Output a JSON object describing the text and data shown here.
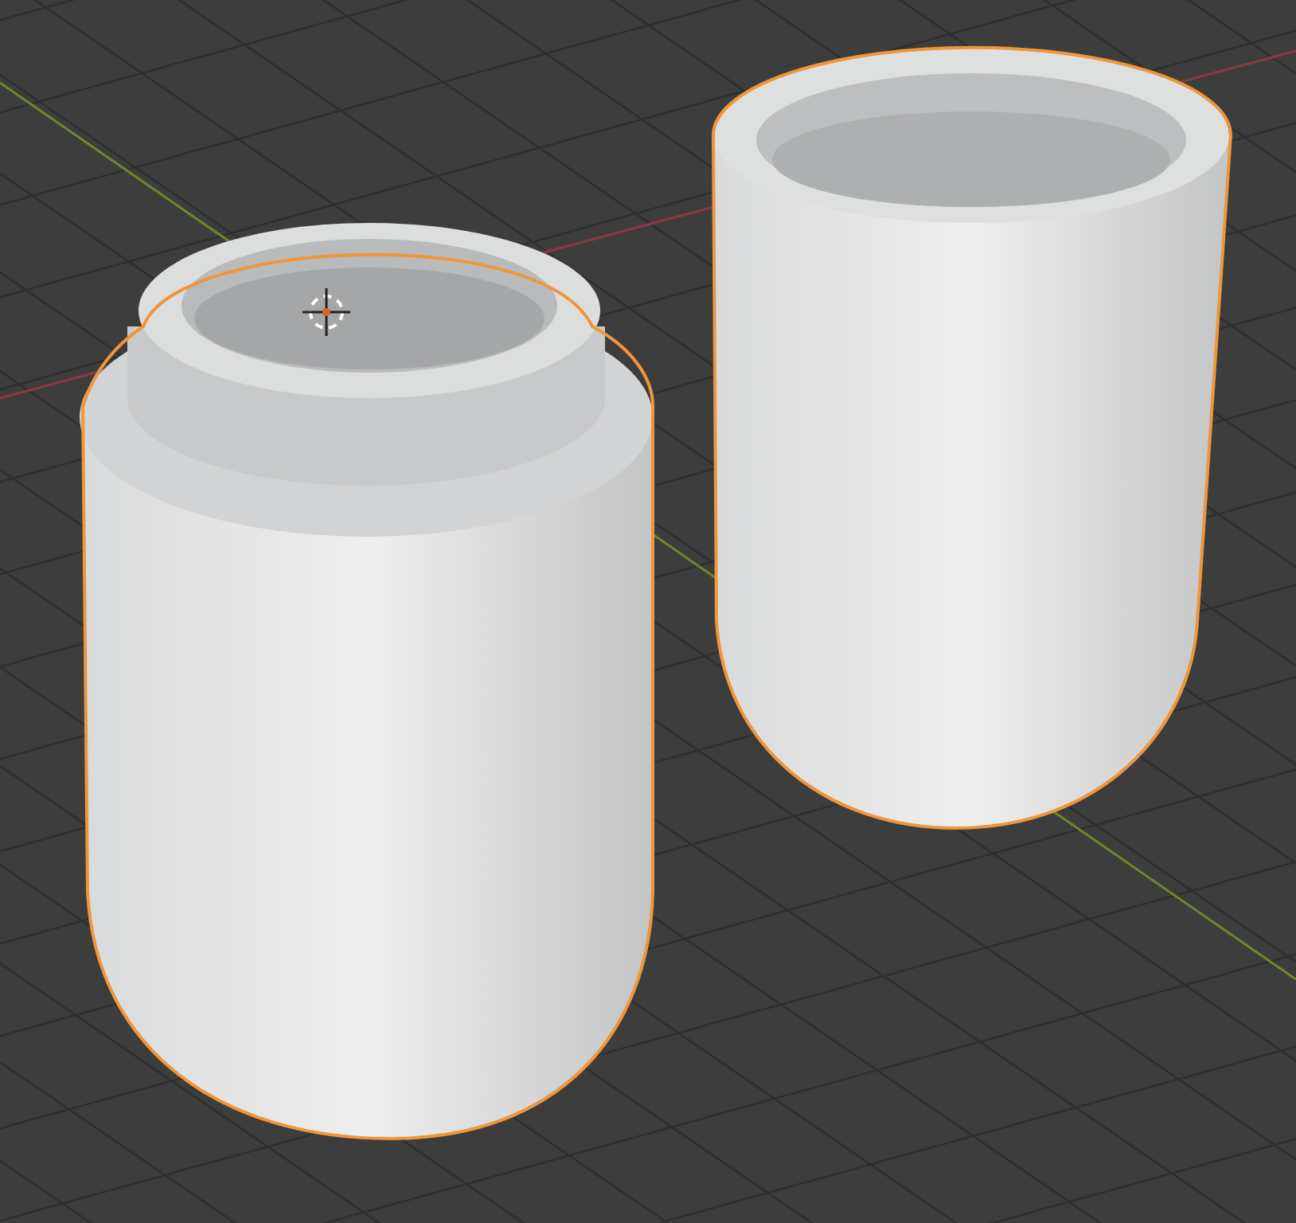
{
  "viewport": {
    "objects": [
      {
        "kind": "threaded-jar",
        "selected": true
      },
      {
        "kind": "open-cup",
        "selected": true
      }
    ],
    "cursor_visible": true
  }
}
